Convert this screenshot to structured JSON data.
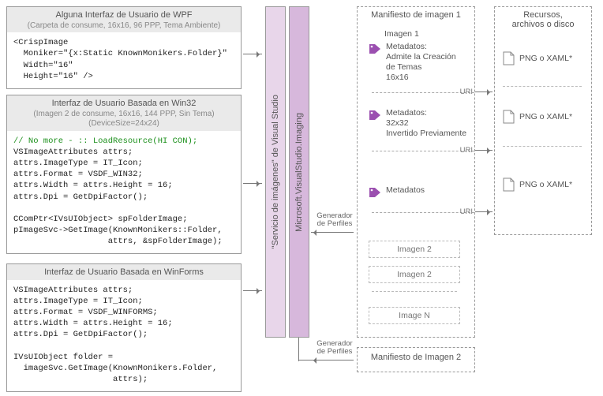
{
  "boxes": {
    "wpf": {
      "title": "Alguna Interfaz de Usuario de WPF",
      "subtitle": "(Carpeta de consume, 16x16, 96 PPP, Tema Ambiente)",
      "code": "<CrispImage\n  Moniker=\"{x:Static KnownMonikers.Folder}\"\n  Width=\"16\"\n  Height=\"16\" />"
    },
    "win32": {
      "title": "Interfaz de Usuario Basada en Win32",
      "subtitle": "(Imagen 2 de consume, 16x16, 144 PPP, Sin Tema)\n(DeviceSize=24x24)",
      "comment": "// No more - :: LoadResource(HI CON);",
      "code": "VSImageAttributes attrs;\nattrs.ImageType = IT_Icon;\nattrs.Format = VSDF_WIN32;\nattrs.Width = attrs.Height = 16;\nattrs.Dpi = GetDpiFactor();\n\nCComPtr<IVsUIObject> spFolderImage;\npImageSvc->GetImage(KnownMonikers::Folder,\n                   attrs, &spFolderImage);"
    },
    "winforms": {
      "title": "Interfaz de Usuario Basada en WinForms",
      "code": "VSImageAttributes attrs;\nattrs.ImageType = IT_Icon;\nattrs.Format = VSDF_WINFORMS;\nattrs.Width = attrs.Height = 16;\nattrs.Dpi = GetDpiFactor();\n\nIVsUIObject folder =\n  imageSvc.GetImage(KnownMonikers.Folder,\n                    attrs);"
    }
  },
  "bars": {
    "service": "\"Servicio de imágenes\" de Visual Studio",
    "namespace": "Microsoft.VisualStudio.Imaging"
  },
  "arrows": {
    "profiler": "Generador\nde Perfiles"
  },
  "manifest1": {
    "title": "Manifiesto de imagen 1",
    "img1": "Imagen 1",
    "meta1": "Metadatos:\nAdmite la Creación\nde Temas\n16x16",
    "meta2": "Metadatos:\n32x32\nInvertido Previamente",
    "meta3": "Metadatos",
    "uri": "URI",
    "sub": {
      "a": "Imagen 2",
      "b": "Imagen 2",
      "c": "Image N"
    }
  },
  "manifest2": {
    "title": "Manifiesto de Imagen 2"
  },
  "resources": {
    "title": "Recursos,\narchivos o disco",
    "item": "PNG o XAML*"
  }
}
